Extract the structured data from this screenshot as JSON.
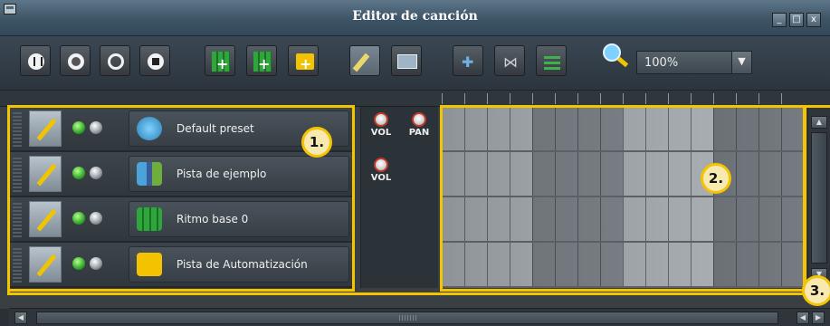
{
  "window": {
    "title": "Editor de canción",
    "controls": [
      "_",
      "□",
      "x"
    ]
  },
  "toolbar": {
    "buttons": [
      "pause-icon",
      "record-icon",
      "record-while-playing-icon",
      "stop-icon",
      "add-beat-bassline-icon",
      "add-sample-track-icon",
      "add-automation-track-icon",
      "draw-mode-icon",
      "edit-mode-icon",
      "add-icon",
      "split-icon",
      "align-icon"
    ],
    "zoom_value": "100%"
  },
  "tracks": [
    {
      "name": "Default preset",
      "icon": "instrument-preset-icon"
    },
    {
      "name": "Pista de ejemplo",
      "icon": "sample-track-icon"
    },
    {
      "name": "Ritmo base 0",
      "icon": "beat-bassline-icon"
    },
    {
      "name": "Pista de Automatización",
      "icon": "automation-folder-icon"
    }
  ],
  "knobs": {
    "row1": {
      "vol": "VOL",
      "pan": "PAN"
    },
    "row2": {
      "vol": "VOL"
    }
  },
  "annotations": {
    "one": "1.",
    "two": "2.",
    "three": "3."
  },
  "colors": {
    "highlight": "#f4c400",
    "mute_led": "#34a82a"
  }
}
